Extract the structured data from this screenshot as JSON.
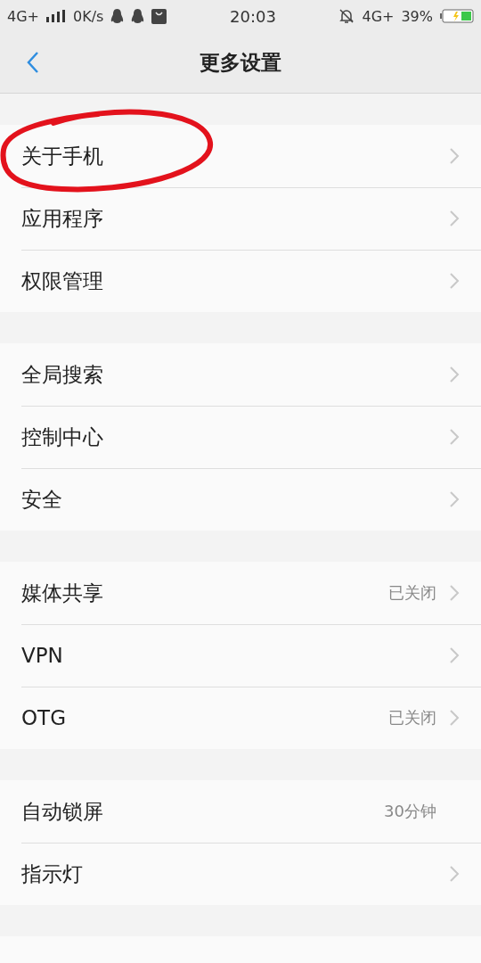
{
  "status_bar": {
    "network_left": "4G+",
    "speed": "0K/s",
    "time": "20:03",
    "network_right": "4G+",
    "battery": "39%"
  },
  "header": {
    "title": "更多设置"
  },
  "groups": [
    {
      "items": [
        {
          "label": "关于手机",
          "chevron": true,
          "circled": true
        },
        {
          "label": "应用程序",
          "chevron": true,
          "circled": false
        },
        {
          "label": "权限管理",
          "chevron": true,
          "circled": false
        }
      ]
    },
    {
      "items": [
        {
          "label": "全局搜索",
          "chevron": true,
          "circled": false
        },
        {
          "label": "控制中心",
          "chevron": true,
          "circled": false
        },
        {
          "label": "安全",
          "chevron": true,
          "circled": false
        }
      ]
    },
    {
      "items": [
        {
          "label": "媒体共享",
          "value": "已关闭",
          "chevron": true,
          "circled": false
        },
        {
          "label": "VPN",
          "chevron": true,
          "circled": false
        },
        {
          "label": "OTG",
          "value": "已关闭",
          "chevron": true,
          "circled": false
        }
      ]
    },
    {
      "items": [
        {
          "label": "自动锁屏",
          "value": "30分钟",
          "chevron": false,
          "circled": false
        },
        {
          "label": "指示灯",
          "chevron": true,
          "circled": false
        }
      ]
    }
  ]
}
